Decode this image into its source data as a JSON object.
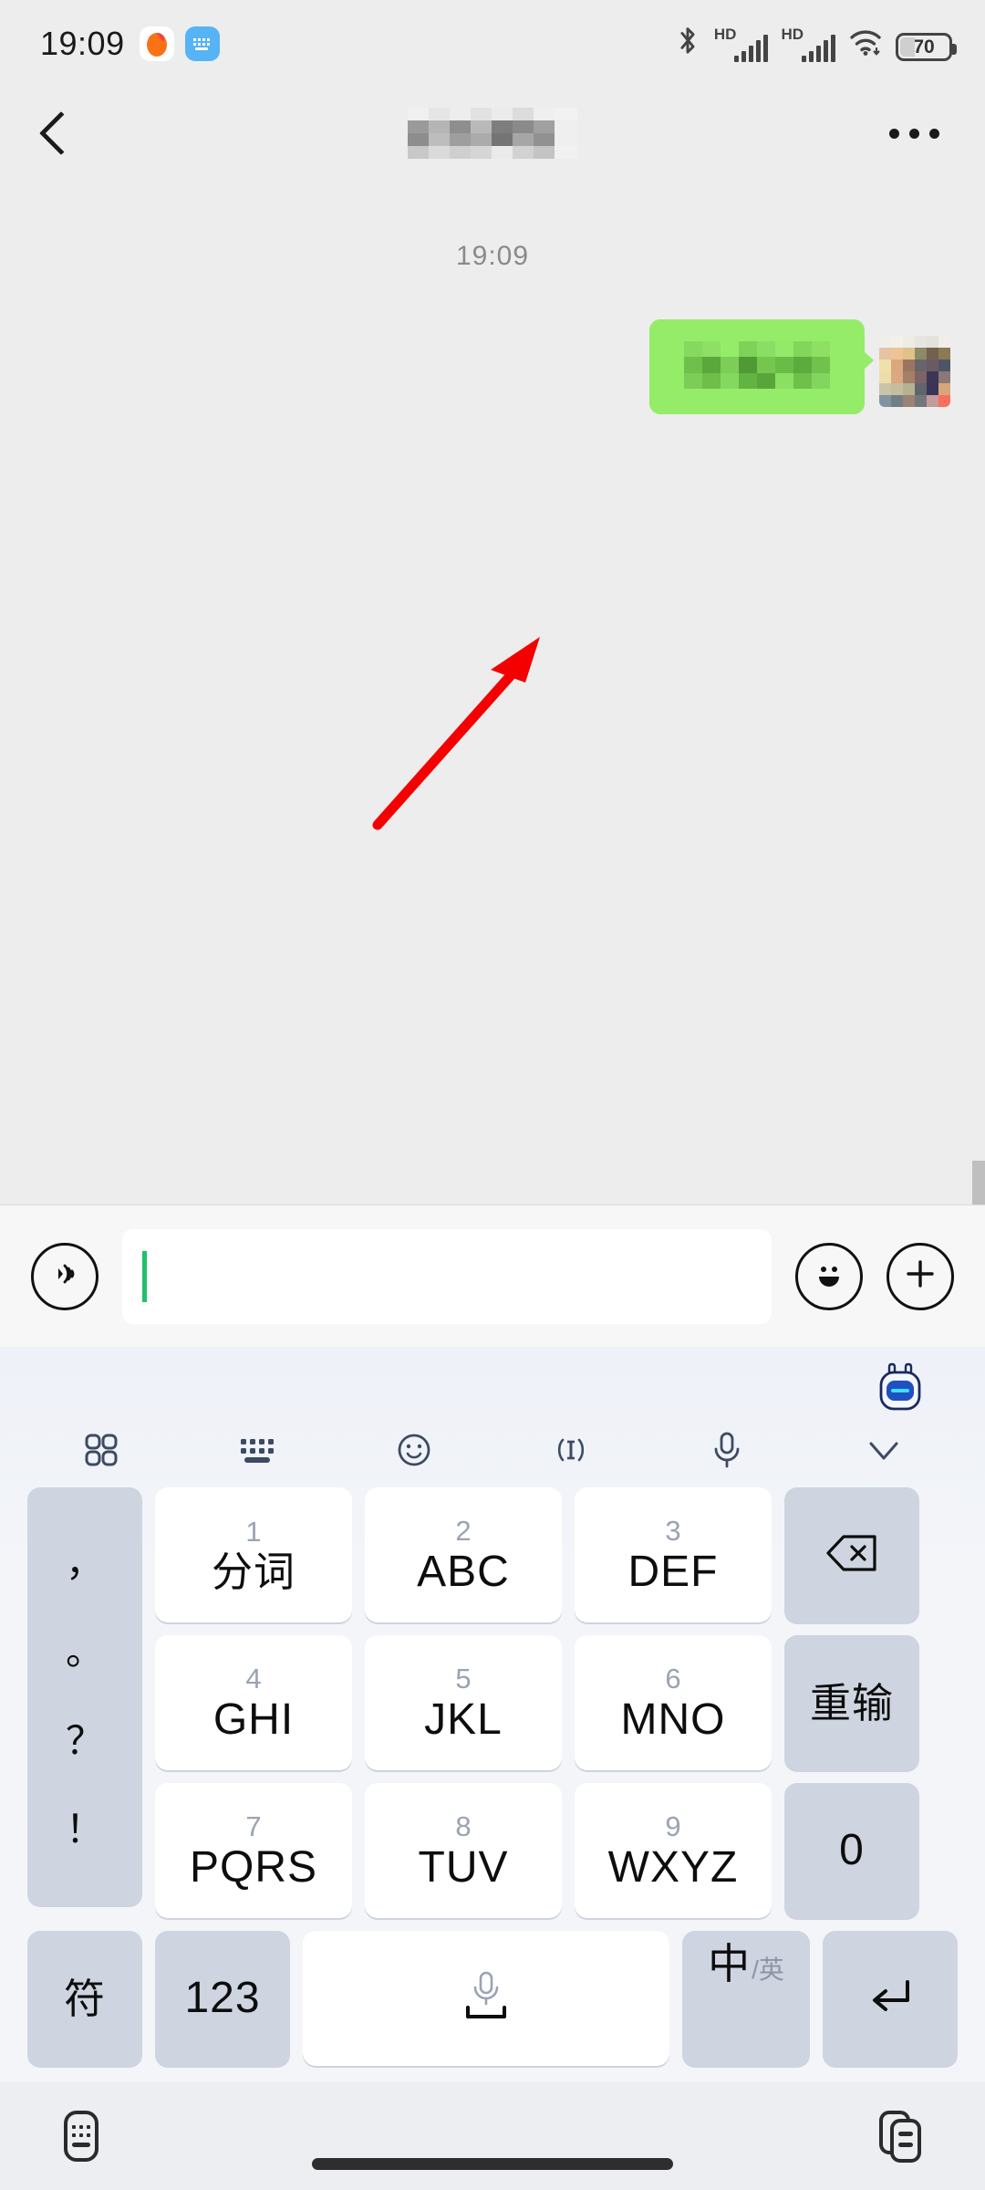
{
  "status_bar": {
    "time": "19:09",
    "battery_level": "70",
    "icons": [
      "app-icon-orange",
      "app-icon-keyboard-blue",
      "bluetooth-icon",
      "hd-signal-icon-1",
      "hd-signal-icon-2",
      "wifi-icon",
      "battery-icon"
    ],
    "hd_label": "HD"
  },
  "nav_header": {
    "back_label": "back-chevron-icon",
    "title_masked": true,
    "more_label": "more-options-icon"
  },
  "chat": {
    "timestamp": "19:09",
    "messages": [
      {
        "side": "outgoing",
        "text_masked": true,
        "bubble_color": "#95ec69",
        "avatar_masked": true
      }
    ],
    "annotation": {
      "type": "arrow",
      "color": "#f40000",
      "points_to": "message-bubble"
    }
  },
  "input_bar": {
    "voice_icon": "voice-input-icon",
    "input_value": "",
    "input_placeholder": "",
    "caret_color": "#21c06c",
    "emoji_icon": "emoji-smiley-icon",
    "plus_icon": "plus-icon"
  },
  "keyboard": {
    "mascot": "ai-robot-mascot-icon",
    "toolbar": [
      {
        "name": "grid-apps-icon"
      },
      {
        "name": "keyboard-layout-icon"
      },
      {
        "name": "emoji-icon"
      },
      {
        "name": "text-cursor-icon"
      },
      {
        "name": "microphone-icon"
      },
      {
        "name": "collapse-chevron-down-icon"
      }
    ],
    "punctuation_key": [
      "，",
      "。",
      "？",
      "！"
    ],
    "rows": [
      [
        {
          "num": "1",
          "label": "分词",
          "style": "white",
          "cjk": true
        },
        {
          "num": "2",
          "label": "ABC",
          "style": "white",
          "cjk": false
        },
        {
          "num": "3",
          "label": "DEF",
          "style": "white",
          "cjk": false
        },
        {
          "num": "",
          "label": "",
          "style": "gray",
          "icon": "backspace-icon"
        }
      ],
      [
        {
          "num": "4",
          "label": "GHI",
          "style": "white",
          "cjk": false
        },
        {
          "num": "5",
          "label": "JKL",
          "style": "white",
          "cjk": false
        },
        {
          "num": "6",
          "label": "MNO",
          "style": "white",
          "cjk": false
        },
        {
          "num": "",
          "label": "重输",
          "style": "gray",
          "cjk": true
        }
      ],
      [
        {
          "num": "7",
          "label": "PQRS",
          "style": "white",
          "cjk": false
        },
        {
          "num": "8",
          "label": "TUV",
          "style": "white",
          "cjk": false
        },
        {
          "num": "9",
          "label": "WXYZ",
          "style": "white",
          "cjk": false
        },
        {
          "num": "",
          "label": "0",
          "style": "gray",
          "cjk": false
        }
      ]
    ],
    "bottom_row": {
      "symbol_key": "符",
      "number_key": "123",
      "space_key": "space-with-microphone-icon",
      "lang_main": "中",
      "lang_sub": "/英",
      "enter_key": "enter-return-icon"
    }
  },
  "bottom_bar": {
    "left_icon": "keyboard-switch-icon",
    "right_icon": "clipboard-icon",
    "gesture_bar": "home-gesture-bar"
  }
}
